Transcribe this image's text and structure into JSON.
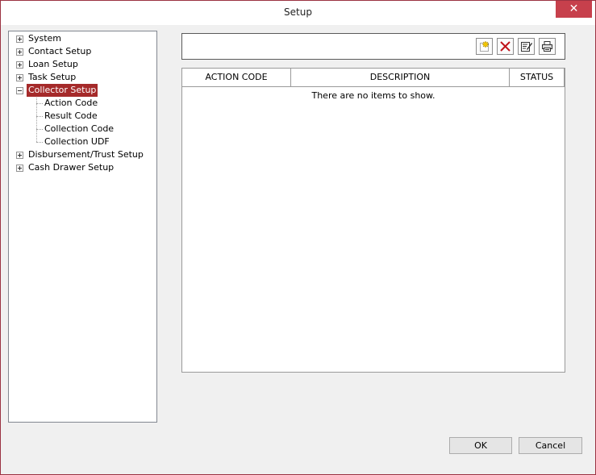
{
  "window": {
    "title": "Setup",
    "close_symbol": "✕"
  },
  "tree": {
    "items": [
      {
        "label": "System",
        "expander": "plus"
      },
      {
        "label": "Contact Setup",
        "expander": "plus"
      },
      {
        "label": "Loan Setup",
        "expander": "plus"
      },
      {
        "label": "Task Setup",
        "expander": "plus"
      },
      {
        "label": "Collector Setup",
        "expander": "minus",
        "selected": true,
        "children": [
          "Action Code",
          "Result Code",
          "Collection Code",
          "Collection UDF"
        ]
      },
      {
        "label": "Disbursement/Trust Setup",
        "expander": "plus"
      },
      {
        "label": "Cash Drawer Setup",
        "expander": "plus"
      }
    ]
  },
  "toolbar": {
    "buttons": [
      "new-icon",
      "delete-icon",
      "edit-icon",
      "print-icon"
    ]
  },
  "grid": {
    "columns": [
      "ACTION CODE",
      "DESCRIPTION",
      "STATUS"
    ],
    "empty_message": "There are no items to show."
  },
  "footer": {
    "ok_label": "OK",
    "cancel_label": "Cancel"
  },
  "colors": {
    "accent": "#a52a2a",
    "close": "#c7404c",
    "border": "#9b3342"
  }
}
